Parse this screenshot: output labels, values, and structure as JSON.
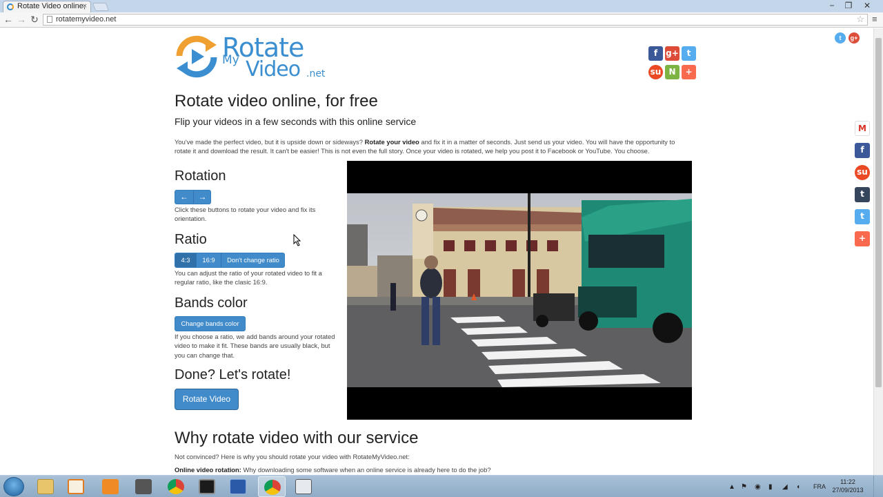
{
  "browser": {
    "tab_title": "Rotate Video online,",
    "tab_close": "×",
    "url": "rotatemyvideo.net",
    "win_min": "−",
    "win_max": "❐",
    "win_close": "✕"
  },
  "logo": {
    "line1": "Rotate",
    "line2": "My",
    "line3": "Video",
    "line4": ".net"
  },
  "page": {
    "title": "Rotate video online, for free",
    "subtitle": "Flip your videos in a few seconds with this online service",
    "intro_1": "You've made the perfect video, but it is upside down or sideways? ",
    "intro_bold": "Rotate your video",
    "intro_2": " and fix it in a matter of seconds. Just send us your video. You will have the opportunity to rotate it and download the result. It can't be easier! This is not even the full story. Once your video is rotated, we help you post it to Facebook or YouTube. You choose."
  },
  "rotation": {
    "title": "Rotation",
    "left_label": "←",
    "right_label": "→",
    "desc": "Click these buttons to rotate your video and fix its orientation."
  },
  "ratio": {
    "title": "Ratio",
    "options": [
      "4:3",
      "16:9",
      "Don't change ratio"
    ],
    "selected": "4:3",
    "desc": "You can adjust the ratio of your rotated video to fit a regular ratio, like the clasic 16:9."
  },
  "bands": {
    "title": "Bands color",
    "button": "Change bands color",
    "desc": "If you choose a ratio, we add bands around your rotated video to make it fit. These bands are usually black, but you can change that."
  },
  "done": {
    "title": "Done? Let's rotate!",
    "button": "Rotate Video"
  },
  "why": {
    "title": "Why rotate video with our service",
    "subtitle": "Not convinced? Here is why you should rotate your video with RotateMyVideo.net:",
    "item_bold": "Online video rotation:",
    "item_text": " Why downloading some software when an online service is already here to do the job?"
  },
  "share": {
    "top_icons": [
      "facebook-icon",
      "google-plus-icon",
      "twitter-icon",
      "stumbleupon-icon",
      "newsvine-icon",
      "addthis-icon"
    ],
    "side_icons": [
      "gmail-icon",
      "facebook-icon",
      "stumbleupon-icon",
      "tumblr-icon",
      "twitter-icon",
      "addthis-icon"
    ],
    "labels": {
      "facebook": "f",
      "gplus": "g+",
      "twitter": "t",
      "stumble": "su",
      "newsvine": "N",
      "add": "+",
      "gmail": "M",
      "tumblr": "t"
    }
  },
  "colors": {
    "accent": "#428bca",
    "accent_active": "#3071a9",
    "facebook": "#3b5998",
    "googleplus": "#dd4b39",
    "twitter": "#55acee",
    "stumbleupon": "#eb4924",
    "newsvine": "#7cb342",
    "addthis": "#f8694d",
    "tumblr": "#35465c"
  },
  "taskbar": {
    "lang": "FRA",
    "time": "11:22",
    "date": "27/09/2013"
  }
}
